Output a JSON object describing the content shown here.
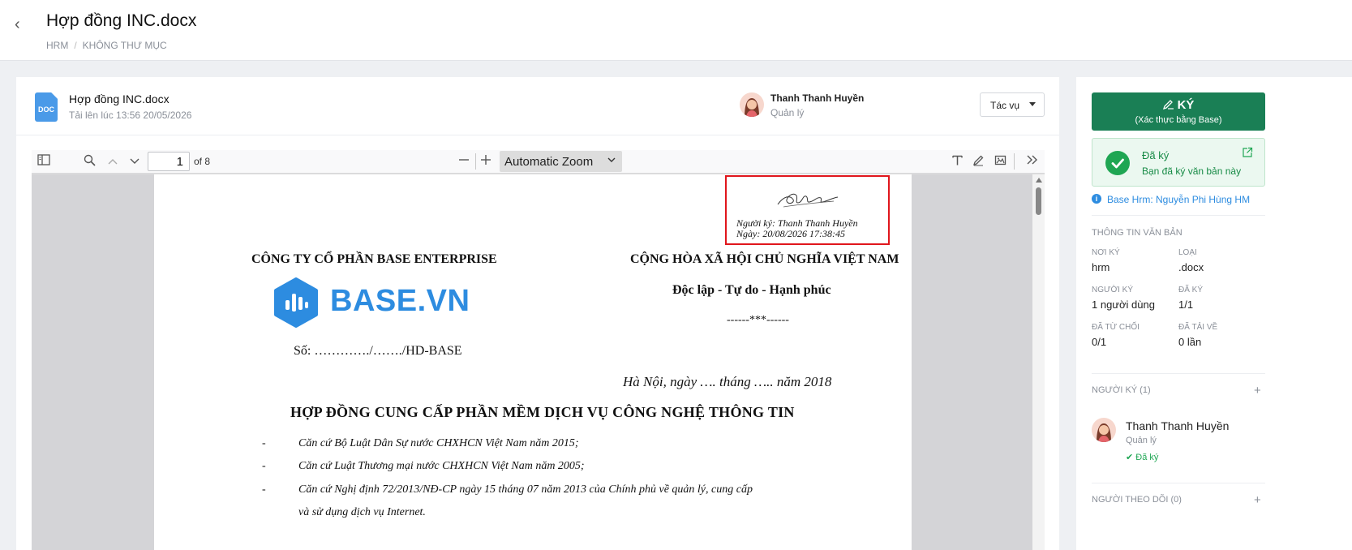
{
  "header": {
    "title": "Hợp đồng INC.docx",
    "breadcrumb": [
      "HRM",
      "KHÔNG THƯ MỤC"
    ]
  },
  "file": {
    "icon": "doc-file-icon",
    "icon_text": "DOC",
    "name": "Hợp đồng INC.docx",
    "uploaded": "Tải lên lúc 13:56 20/05/2026",
    "owner_name": "Thanh Thanh Huyền",
    "owner_role": "Quản lý",
    "action_label": "Tác vụ"
  },
  "viewer": {
    "page_current": "1",
    "page_total_label": "of 8",
    "zoom": "Automatic Zoom"
  },
  "document": {
    "signature": {
      "signer_line": "Người ký: Thanh Thanh Huyền",
      "date_line": "Ngày: 20/08/2026 17:38:45"
    },
    "company": "CÔNG TY CỔ PHẦN BASE ENTERPRISE",
    "country": "CỘNG HÒA XÃ HỘI CHỦ NGHĨA VIỆT NAM",
    "motto": "Độc lập - Tự do - Hạnh phúc",
    "stars": "------***------",
    "logo_text": "BASE.VN",
    "doc_no": "Số: …………./……./HD-BASE",
    "place_date": "Hà Nội, ngày …. tháng ….. năm 2018",
    "contract_title": "HỢP  ĐỒNG CUNG CẤP PHẦN  MỀM DỊCH VỤ CÔNG NGHỆ THÔNG TIN",
    "clauses": [
      "Căn cứ Bộ Luật Dân Sự nước CHXHCN Việt Nam năm 2015;",
      "Căn cứ Luật Thương mại nước CHXHCN Việt Nam năm 2005;",
      "Căn cứ Nghị định 72/2013/NĐ-CP ngày 15 tháng 07 năm 2013 của Chính phủ về quản lý, cung cấp",
      "và sử dụng dịch vụ Internet."
    ],
    "dash": "-"
  },
  "side": {
    "sign_label": "KÝ",
    "sign_sub": "(Xác thực bằng Base)",
    "signed_title": "Đã ký",
    "signed_sub": "Bạn đã ký văn bản này",
    "base_hrm": "Base Hrm: Nguyễn Phi Hùng HM",
    "info_title": "THÔNG TIN VĂN BẢN",
    "meta": [
      {
        "k": "NƠI KÝ",
        "v": "hrm"
      },
      {
        "k": "LOẠI",
        "v": ".docx"
      },
      {
        "k": "NGƯỜI KÝ",
        "v": "1 người dùng"
      },
      {
        "k": "ĐÃ KÝ",
        "v": "1/1"
      },
      {
        "k": "ĐÃ TỪ CHỐI",
        "v": "0/1"
      },
      {
        "k": "ĐÃ TẢI VỀ",
        "v": "0 lần"
      }
    ],
    "signers_title": "NGƯỜI KÝ (1)",
    "signer": {
      "name": "Thanh Thanh Huyền",
      "role": "Quản lý",
      "status": "✔ Đã ký"
    },
    "followers_title": "NGƯỜI THEO DÕI (0)",
    "plus": "+"
  },
  "colors": {
    "brand_green": "#1a7f55",
    "success": "#1fa653",
    "link_blue": "#2d8ce0",
    "highlight_red": "#e0161c"
  }
}
